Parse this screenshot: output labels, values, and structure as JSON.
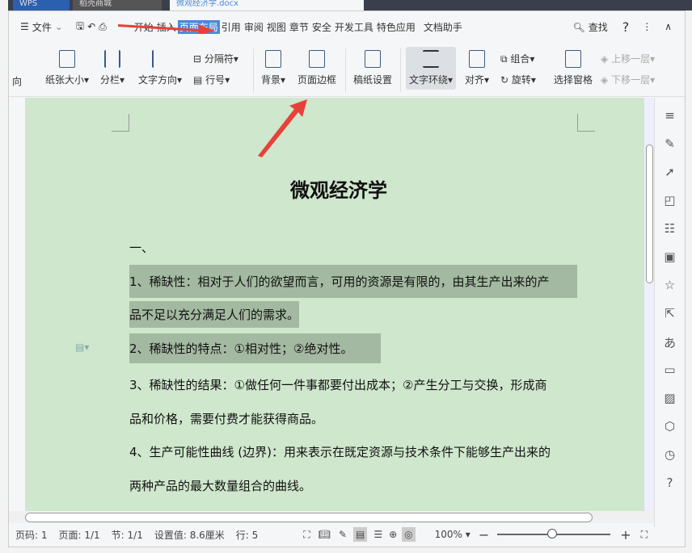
{
  "titlebar": {
    "tabs": [
      "WPS",
      "稻壳商城",
      "微观经济学.docx"
    ]
  },
  "menu": {
    "file": "文件",
    "items": [
      "开始",
      "插入",
      "页面布局",
      "引用",
      "审阅",
      "视图",
      "章节",
      "安全",
      "开发工具",
      "特色应用",
      "文档助手"
    ],
    "active": "页面布局",
    "search": "查找"
  },
  "ribbon": {
    "orientation_partial": "向",
    "paper_size": "纸张大小",
    "columns": "分栏",
    "text_direction": "文字方向",
    "separator": "分隔符",
    "line_number": "行号",
    "background": "背景",
    "page_border": "页面边框",
    "manuscript": "稿纸设置",
    "text_wrap": "文字环绕",
    "align": "对齐",
    "group": "组合",
    "rotate": "旋转",
    "selection_pane": "选择窗格",
    "bring_forward": "上移一层",
    "send_backward": "下移一层"
  },
  "document": {
    "title": "微观经济学",
    "lines": [
      "一、",
      "1、稀缺性：相对于人们的欲望而言，可用的资源是有限的，由其生产出来的产",
      "品不足以充分满足人们的需求。",
      "2、稀缺性的特点：①相对性；②绝对性。",
      "3、稀缺性的结果：①做任何一件事都要付出成本；②产生分工与交换，形成商",
      "品和价格，需要付费才能获得商品。",
      "4、生产可能性曲线 (边界)：用来表示在既定资源与技术条件下能够生产出来的",
      "两种产品的最大数量组合的曲线。"
    ]
  },
  "status": {
    "page_num": "页码: 1",
    "pages": "页面: 1/1",
    "section": "节: 1/1",
    "setting": "设置值: 8.6厘米",
    "row": "行: 5",
    "zoom": "100%",
    "zoom_level": 100
  },
  "colors": {
    "accent": "#4a8ad9",
    "doc_bg": "#cfe7cd",
    "highlight": "#a3b9a1",
    "arrow": "#e8413a"
  }
}
